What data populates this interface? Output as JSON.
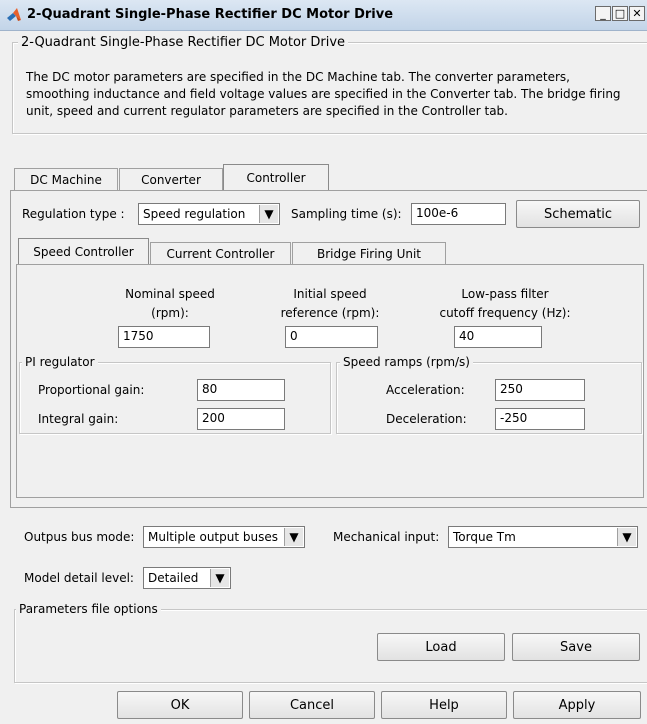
{
  "window": {
    "title": "2-Quadrant Single-Phase Rectifier DC Motor Drive"
  },
  "block": {
    "group_title": "2-Quadrant Single-Phase Rectifier DC Motor Drive",
    "description": "The DC motor parameters are specified in the DC Machine tab. The converter parameters, smoothing inductance and field voltage values are specified in the Converter tab. The bridge firing unit, speed and current regulator parameters are specified in the Controller tab."
  },
  "tabs": [
    {
      "label": "DC Machine"
    },
    {
      "label": "Converter"
    },
    {
      "label": "Controller",
      "active": true
    }
  ],
  "controller": {
    "regulation_type_label": "Regulation type :",
    "regulation_type_value": "Speed regulation",
    "sampling_time_label": "Sampling time (s):",
    "sampling_time_value": "100e-6",
    "schematic_button": "Schematic",
    "subtabs": [
      {
        "label": "Speed Controller",
        "active": true
      },
      {
        "label": "Current Controller"
      },
      {
        "label": "Bridge Firing Unit"
      }
    ],
    "nominal_speed_label_1": "Nominal speed",
    "nominal_speed_label_2": "(rpm):",
    "nominal_speed_value": "1750",
    "initial_speed_label_1": "Initial speed",
    "initial_speed_label_2": "reference (rpm):",
    "initial_speed_value": "0",
    "lowpass_label_1": "Low-pass filter",
    "lowpass_label_2": "cutoff frequency (Hz):",
    "lowpass_value": "40",
    "pi_group_title": "PI regulator",
    "proportional_gain_label": "Proportional gain:",
    "proportional_gain_value": "80",
    "integral_gain_label": "Integral gain:",
    "integral_gain_value": "200",
    "ramps_group_title": "Speed ramps (rpm/s)",
    "acceleration_label": "Acceleration:",
    "acceleration_value": "250",
    "deceleration_label": "Deceleration:",
    "deceleration_value": "-250"
  },
  "bottom": {
    "output_bus_label": "Outpus bus mode:",
    "output_bus_value": "Multiple output buses",
    "mechanical_input_label": "Mechanical input:",
    "mechanical_input_value": "Torque Tm",
    "model_detail_label": "Model detail level:",
    "model_detail_value": "Detailed",
    "params_file_title": "Parameters file options",
    "load_button": "Load",
    "save_button": "Save"
  },
  "footer": {
    "ok": "OK",
    "cancel": "Cancel",
    "help": "Help",
    "apply": "Apply"
  }
}
